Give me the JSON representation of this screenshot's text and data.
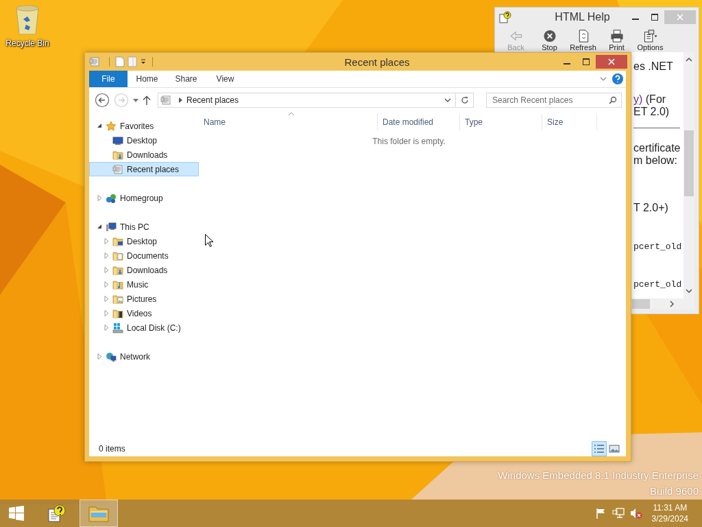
{
  "desktop": {
    "icons": [
      {
        "label": "Recycle Bin"
      }
    ],
    "os_watermark": [
      "Windows Embedded 8.1 Industry Enterprise",
      "Build 9600"
    ]
  },
  "help_window": {
    "title": "HTML Help",
    "toolbar": [
      {
        "label": "Back",
        "kind": "back",
        "disabled": true
      },
      {
        "label": "Stop",
        "kind": "stop",
        "disabled": false
      },
      {
        "label": "Refresh",
        "kind": "refresh",
        "disabled": false
      },
      {
        "label": "Print",
        "kind": "print",
        "disabled": false
      },
      {
        "label": "Options",
        "kind": "options",
        "disabled": false
      }
    ],
    "content_lines": [
      {
        "kind": "text",
        "text": "es .NET"
      },
      {
        "kind": "link",
        "link": "y)",
        "text": " (For"
      },
      {
        "kind": "text",
        "text": "ET 2.0)"
      },
      {
        "kind": "rule"
      },
      {
        "kind": "text",
        "text": "certificate"
      },
      {
        "kind": "text",
        "text": "m below:"
      },
      {
        "kind": "text",
        "text": "T 2.0+)"
      },
      {
        "kind": "code",
        "text": "pcert_old"
      },
      {
        "kind": "code",
        "text": "pcert_old"
      }
    ]
  },
  "explorer": {
    "title": "Recent places",
    "ribbon_tabs": [
      {
        "label": "File",
        "kind": "file"
      },
      {
        "label": "Home",
        "kind": "tab"
      },
      {
        "label": "Share",
        "kind": "tab"
      },
      {
        "label": "View",
        "kind": "tab"
      }
    ],
    "nav_buttons": [
      {
        "kind": "back",
        "disabled": false
      },
      {
        "kind": "forward",
        "disabled": true
      }
    ],
    "address": "Recent places",
    "search": {
      "placeholder": "Search Recent places"
    },
    "tree": [
      {
        "label": "Favorites",
        "kind": "star",
        "expanded": true,
        "selected": false,
        "children": [
          {
            "label": "Desktop",
            "kind": "desktop",
            "selected": false
          },
          {
            "label": "Downloads",
            "kind": "downloads",
            "selected": false
          },
          {
            "label": "Recent places",
            "kind": "recent",
            "selected": true
          }
        ]
      },
      {
        "label": "Homegroup",
        "kind": "homegroup",
        "expanded": false,
        "selected": false
      },
      {
        "label": "This PC",
        "kind": "computer",
        "expanded": true,
        "selected": false,
        "children": [
          {
            "label": "Desktop",
            "kind": "folder-desktop",
            "expanded": false,
            "selected": false
          },
          {
            "label": "Documents",
            "kind": "documents",
            "expanded": false,
            "selected": false
          },
          {
            "label": "Downloads",
            "kind": "downloads",
            "expanded": false,
            "selected": false
          },
          {
            "label": "Music",
            "kind": "music",
            "expanded": false,
            "selected": false
          },
          {
            "label": "Pictures",
            "kind": "pictures",
            "expanded": false,
            "selected": false
          },
          {
            "label": "Videos",
            "kind": "videos",
            "expanded": false,
            "selected": false
          },
          {
            "label": "Local Disk (C:)",
            "kind": "drive",
            "expanded": false,
            "selected": false
          }
        ]
      },
      {
        "label": "Network",
        "kind": "network",
        "expanded": false,
        "selected": false
      }
    ],
    "columns": [
      {
        "label": "Name",
        "sorted": true
      },
      {
        "label": "Date modified",
        "sorted": false
      },
      {
        "label": "Type",
        "sorted": false
      },
      {
        "label": "Size",
        "sorted": false
      }
    ],
    "empty_message": "This folder is empty.",
    "status": "0 items",
    "view_buttons": [
      {
        "kind": "details",
        "selected": true
      },
      {
        "kind": "large-icons",
        "selected": false
      }
    ]
  },
  "taskbar": {
    "items": [
      {
        "kind": "help",
        "active": false
      },
      {
        "kind": "explorer",
        "active": true
      }
    ],
    "clock": {
      "time": "11:31 AM",
      "date": "3/29/2024"
    }
  }
}
